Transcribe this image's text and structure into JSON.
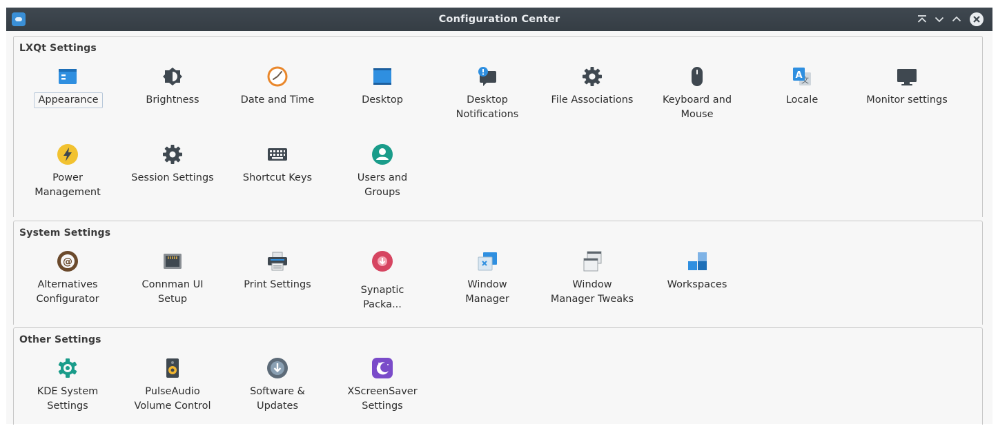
{
  "window": {
    "title": "Configuration Center",
    "controls": [
      "keep-above",
      "minimize",
      "maximize",
      "close"
    ]
  },
  "groups": [
    {
      "title": "LXQt Settings",
      "items": [
        {
          "label": "Appearance",
          "icon": "appearance-icon",
          "selected": true
        },
        {
          "label": "Brightness",
          "icon": "brightness-icon"
        },
        {
          "label": "Date and Time",
          "icon": "clock-icon"
        },
        {
          "label": "Desktop",
          "icon": "desktop-icon"
        },
        {
          "label": "Desktop\nNotifications",
          "icon": "notifications-icon"
        },
        {
          "label": "File Associations",
          "icon": "gear-icon"
        },
        {
          "label": "Keyboard and\nMouse",
          "icon": "mouse-icon"
        },
        {
          "label": "Locale",
          "icon": "locale-icon"
        },
        {
          "label": "Monitor settings",
          "icon": "monitor-icon"
        },
        {
          "label": "Power\nManagement",
          "icon": "power-icon"
        },
        {
          "label": "Session Settings",
          "icon": "gear-icon"
        },
        {
          "label": "Shortcut Keys",
          "icon": "keyboard-icon"
        },
        {
          "label": "Users and\nGroups",
          "icon": "user-icon"
        }
      ]
    },
    {
      "title": "System Settings",
      "items": [
        {
          "label": "Alternatives\nConfigurator",
          "icon": "alternatives-icon"
        },
        {
          "label": "Connman UI\nSetup",
          "icon": "network-port-icon"
        },
        {
          "label": "Print Settings",
          "icon": "printer-icon"
        },
        {
          "label": "Synaptic\nPacka...",
          "icon": "synaptic-icon"
        },
        {
          "label": "Window\nManager",
          "icon": "window-manager-icon"
        },
        {
          "label": "Window\nManager Tweaks",
          "icon": "window-tweaks-icon"
        },
        {
          "label": "Workspaces",
          "icon": "workspaces-icon"
        }
      ]
    },
    {
      "title": "Other Settings",
      "items": [
        {
          "label": "KDE System\nSettings",
          "icon": "kde-settings-icon"
        },
        {
          "label": "PulseAudio\nVolume Control",
          "icon": "speaker-icon"
        },
        {
          "label": "Software &\nUpdates",
          "icon": "software-updates-icon"
        },
        {
          "label": "XScreenSaver\nSettings",
          "icon": "screensaver-icon"
        }
      ]
    }
  ],
  "colors": {
    "titlebar": "#3b444b",
    "accent_blue": "#2f8fe0",
    "power_yellow": "#f2c230",
    "user_teal": "#1a9c8a",
    "synaptic_red": "#d64561",
    "screensaver_purple": "#7a4bc9"
  }
}
